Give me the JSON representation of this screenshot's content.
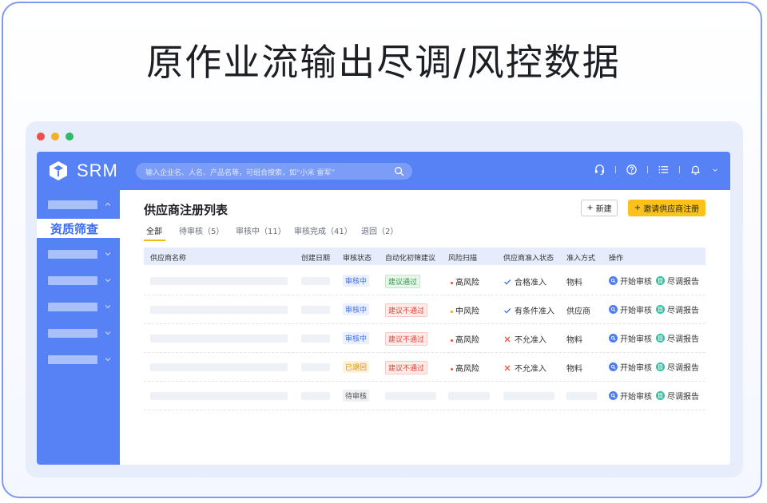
{
  "headline": "原作业流输出尽调/风控数据",
  "window_dots": [
    "#ef4e4b",
    "#f4b02c",
    "#2fba65"
  ],
  "app": {
    "brand": "SRM",
    "search_placeholder": "输入企业名、人名、产品名等，可组合搜索，如“小米 雷军”",
    "topbar_icons": [
      "headset-icon",
      "help-icon",
      "list-icon",
      "bell-icon",
      "chevron-down-icon"
    ],
    "accent": "#5682f5"
  },
  "sidebar": {
    "active_label": "资质筛查",
    "group_count": 6
  },
  "page": {
    "title": "供应商注册列表",
    "btn_new": "新建",
    "btn_invite": "邀请供应商注册"
  },
  "tabs": [
    {
      "label": "全部",
      "active": true
    },
    {
      "label": "待审核（5）"
    },
    {
      "label": "审核中（11）"
    },
    {
      "label": "审核完成（41）"
    },
    {
      "label": "退回（2）"
    }
  ],
  "table": {
    "headers": [
      "供应商名称",
      "创建日期",
      "审核状态",
      "自动化初筛建议",
      "风险扫描",
      "供应商准入状态",
      "准入方式",
      "操作"
    ],
    "rows": [
      {
        "status": "审核中",
        "suggestion": "建议通过",
        "risk": "高风险",
        "admit": "合格准入",
        "method": "物料"
      },
      {
        "status": "审核中",
        "suggestion": "建议不通过",
        "risk": "中风险",
        "admit": "有条件准入",
        "method": "供应商"
      },
      {
        "status": "审核中",
        "suggestion": "建议不通过",
        "risk": "高风险",
        "admit": "不允准入",
        "method": "物料"
      },
      {
        "status": "已退回",
        "suggestion": "建议不通过",
        "risk": "高风险",
        "admit": "不允准入",
        "method": "物料"
      },
      {
        "status": "待审核",
        "suggestion": "",
        "risk": "",
        "admit": "",
        "method": ""
      }
    ],
    "ops": {
      "start": "开始审核",
      "report": "尽调报告"
    }
  }
}
